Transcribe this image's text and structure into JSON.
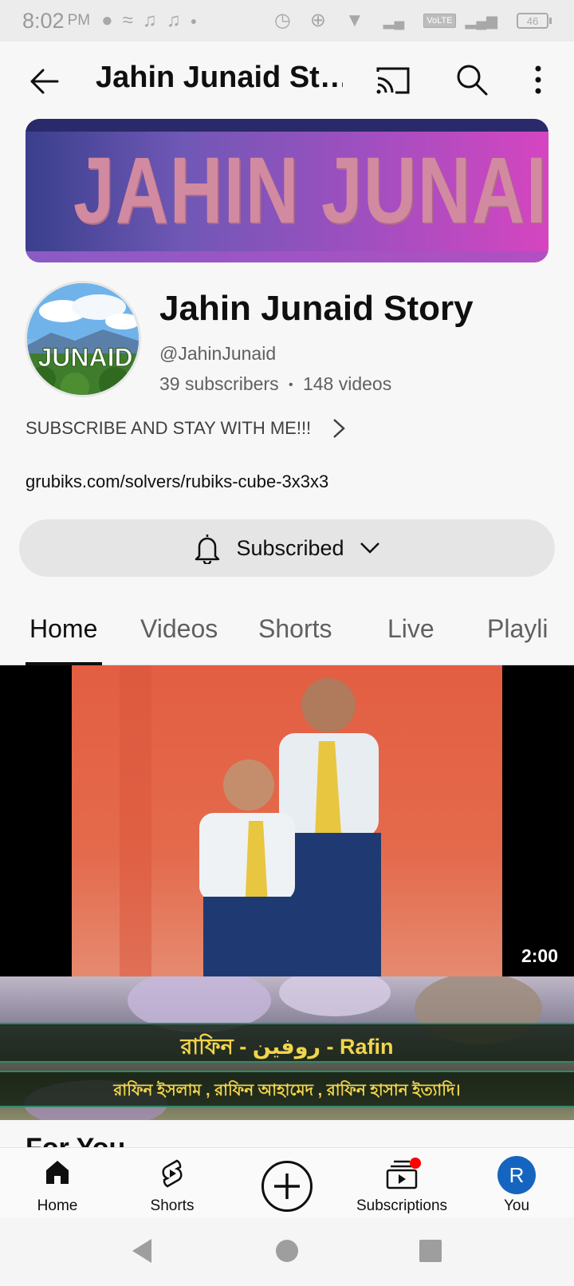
{
  "status_bar": {
    "time": "8:02",
    "ampm": "PM",
    "volte": "VoLTE",
    "battery": "46"
  },
  "app_bar": {
    "title": "Jahin Junaid St…"
  },
  "banner": {
    "text": "JAHIN JUNAID"
  },
  "avatar": {
    "text": "JUNAID"
  },
  "channel": {
    "name": "Jahin Junaid Story",
    "handle": "@JahinJunaid",
    "subscribers": "39 subscribers",
    "separator": "•",
    "videos": "148 videos",
    "description": "SUBSCRIBE AND STAY WITH ME!!!",
    "link": "grubiks.com/solvers/rubiks-cube-3x3x3"
  },
  "subscribe_button": {
    "label": "Subscribed"
  },
  "tabs": [
    {
      "label": "Home",
      "active": true
    },
    {
      "label": "Videos"
    },
    {
      "label": "Shorts"
    },
    {
      "label": "Live"
    },
    {
      "label": "Playli"
    }
  ],
  "featured_video": {
    "duration": "2:00"
  },
  "next_thumbnail": {
    "title": "রাফিন - روفين - Rafin",
    "subtitle": "রাফিন ইসলাম , রাফিন আহামেদ , রাফিন হাসান ইত্যাদি।"
  },
  "section": {
    "title": "For You"
  },
  "bottom_nav": [
    {
      "label": "Home",
      "icon": "home-icon"
    },
    {
      "label": "Shorts",
      "icon": "shorts-icon"
    },
    {
      "label": "",
      "icon": "create-icon"
    },
    {
      "label": "Subscriptions",
      "icon": "subscriptions-icon"
    },
    {
      "label": "You",
      "icon": "avatar"
    }
  ],
  "you_avatar_letter": "R",
  "colors": {
    "accent_red": "#ff0000",
    "avatar_blue": "#1565c0",
    "text": "#0f0f0f",
    "secondary": "#606060"
  }
}
